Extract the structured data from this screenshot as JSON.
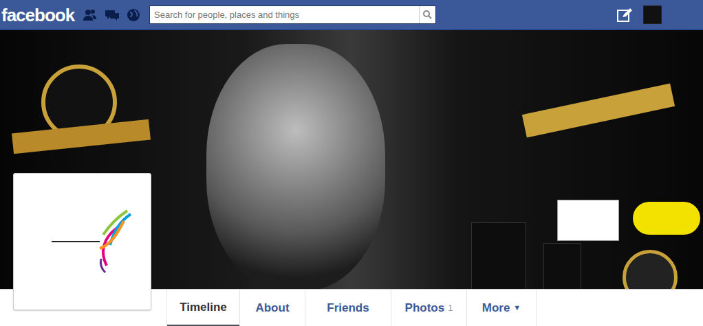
{
  "header": {
    "logo": "facebook",
    "search": {
      "placeholder": "Search for people, places and things"
    }
  },
  "tabs": [
    {
      "label": "Timeline",
      "count": "",
      "arrow": "",
      "selected": true
    },
    {
      "label": "About",
      "count": "",
      "arrow": "",
      "selected": false
    },
    {
      "label": "Friends",
      "count": "",
      "arrow": "",
      "selected": false
    },
    {
      "label": "Photos",
      "count": "1",
      "arrow": "",
      "selected": false
    },
    {
      "label": "More",
      "count": "",
      "arrow": "▼",
      "selected": false
    }
  ]
}
